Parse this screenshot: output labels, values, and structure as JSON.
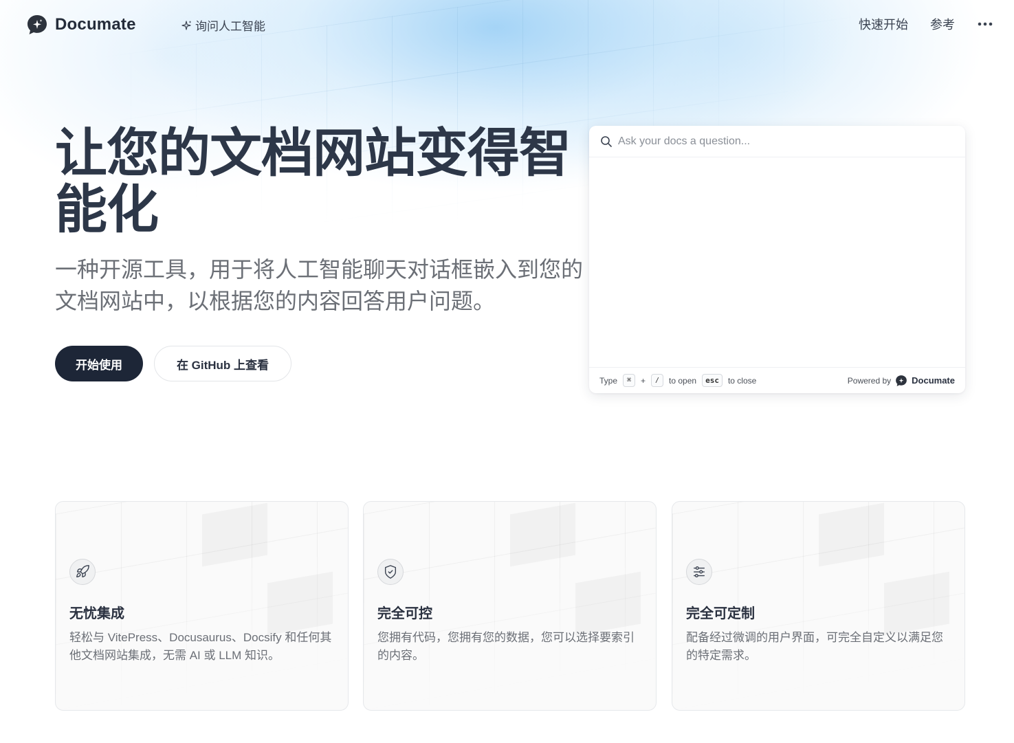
{
  "brand": {
    "name": "Documate"
  },
  "nav": {
    "ask_ai": "询问人工智能",
    "links": [
      "快速开始",
      "参考"
    ]
  },
  "hero": {
    "title": "让您的文档网站变得智能化",
    "subtitle": "一种开源工具，用于将人工智能聊天对话框嵌入到您的文档网站中，以根据您的内容回答用户问题。",
    "primary_button": "开始使用",
    "secondary_button": "在 GitHub 上查看"
  },
  "widget": {
    "placeholder": "Ask your docs a question...",
    "footer": {
      "type": "Type",
      "key_cmd": "⌘",
      "plus": "+",
      "key_slash": "/",
      "to_open": "to open",
      "key_esc": "esc",
      "to_close": "to close",
      "powered_by": "Powered by",
      "brand": "Documate"
    }
  },
  "features": [
    {
      "icon": "rocket-icon",
      "title": "无忧集成",
      "desc": "轻松与 VitePress、Docusaurus、Docsify 和任何其他文档网站集成，无需 AI 或 LLM 知识。"
    },
    {
      "icon": "shield-check-icon",
      "title": "完全可控",
      "desc": "您拥有代码，您拥有您的数据，您可以选择要索引的内容。"
    },
    {
      "icon": "sliders-icon",
      "title": "完全可定制",
      "desc": "配备经过微调的用户界面，可完全自定义以满足您的特定需求。"
    }
  ],
  "colors": {
    "primary_button_bg": "#1d2637",
    "heading": "#2d3748",
    "subtext": "#6b6f76",
    "glow": "#9ccdf2"
  }
}
